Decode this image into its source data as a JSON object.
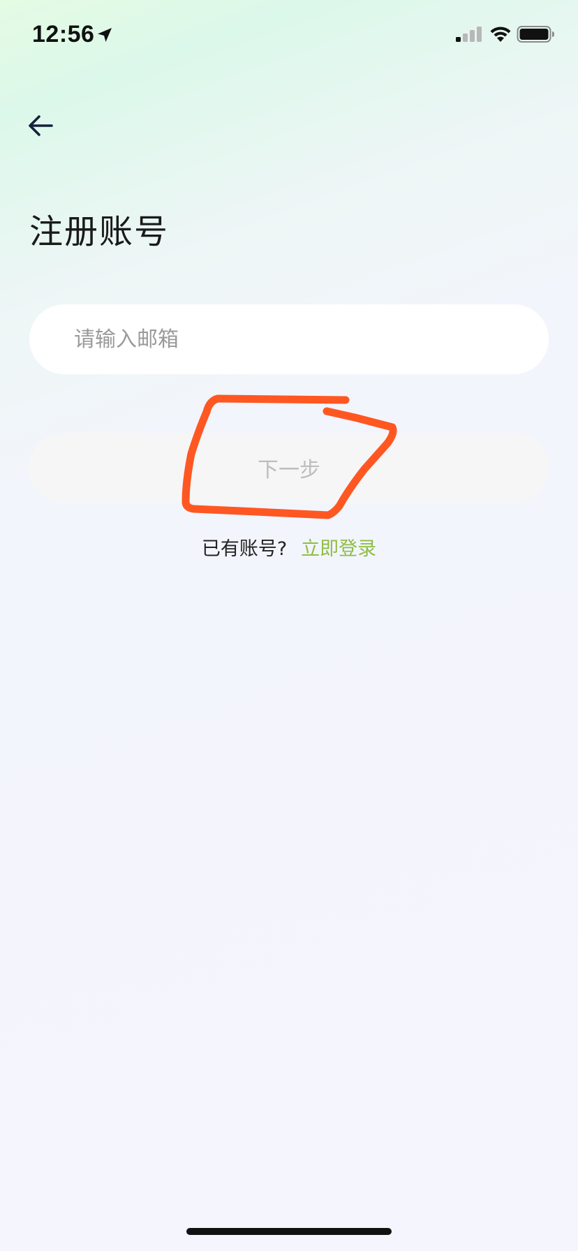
{
  "status_bar": {
    "time": "12:56",
    "icons": [
      "location-arrow-icon",
      "cellular-signal-icon",
      "wifi-icon",
      "battery-icon"
    ]
  },
  "nav": {
    "back_icon": "arrow-left-icon"
  },
  "page": {
    "title": "注册账号"
  },
  "form": {
    "email_placeholder": "请输入邮箱",
    "email_value": "",
    "next_label": "下一步"
  },
  "footer": {
    "prompt": "已有账号?",
    "login_link": "立即登录"
  },
  "colors": {
    "accent_green": "#8dbd46",
    "annotation_orange": "#ff5722"
  }
}
